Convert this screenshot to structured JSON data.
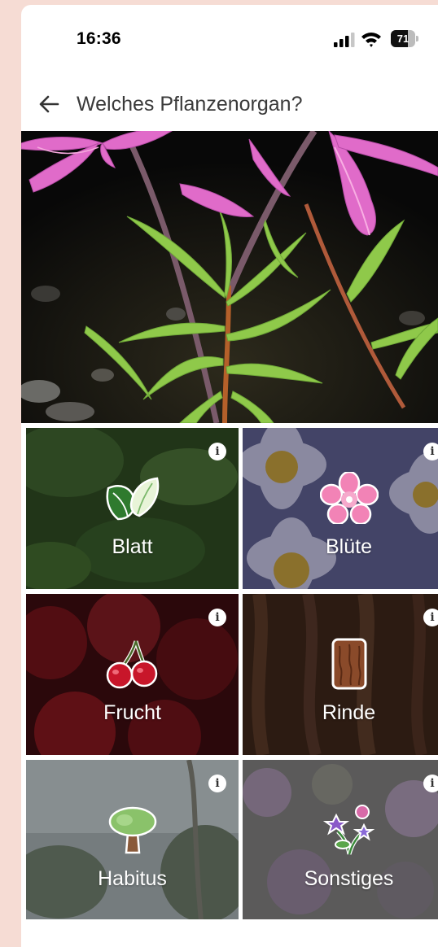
{
  "status_bar": {
    "time": "16:36",
    "battery_level": "71",
    "battery_fraction": 0.71
  },
  "header": {
    "title": "Welches Pflanzenorgan?",
    "back_icon": "arrow-left-icon"
  },
  "hero": {
    "subject": "pink-flower-photo"
  },
  "organs": [
    {
      "label": "Blatt",
      "icon": "leaf-icon",
      "info_icon": "info-icon"
    },
    {
      "label": "Blüte",
      "icon": "flower-icon",
      "info_icon": "info-icon"
    },
    {
      "label": "Frucht",
      "icon": "cherry-icon",
      "info_icon": "info-icon"
    },
    {
      "label": "Rinde",
      "icon": "bark-icon",
      "info_icon": "info-icon"
    },
    {
      "label": "Habitus",
      "icon": "tree-icon",
      "info_icon": "info-icon"
    },
    {
      "label": "Sonstiges",
      "icon": "flowers-bouquet-icon",
      "info_icon": "info-icon"
    }
  ],
  "colors": {
    "page_background": "#f6dcd4",
    "leaf_green": "#2f6b2a",
    "flower_pink": "#f06eaa",
    "cherry_red": "#c8162a",
    "bark_brown": "#8a4a2a"
  }
}
